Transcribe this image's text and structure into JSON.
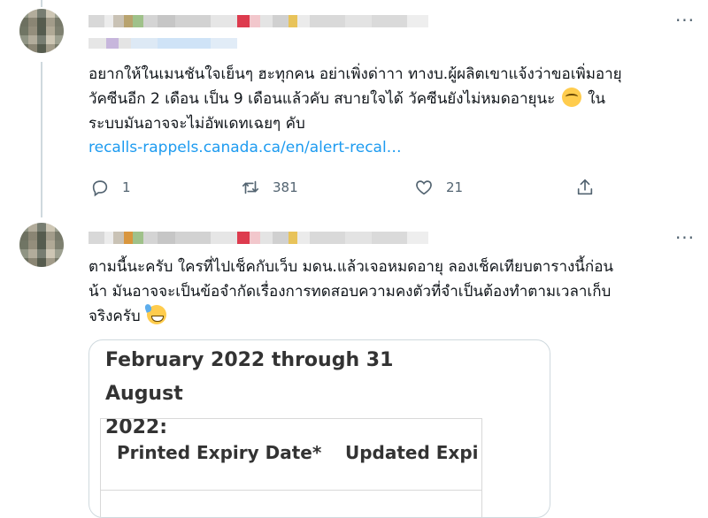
{
  "tweet1": {
    "text_lines": [
      "อยากให้ในเมนชันใจเย็นๆ ฮะทุกคน อย่าเพิ่งด่าาา ทางบ.ผู้ผลิตเขาแจ้งว่าขอเพิ่มอายุ",
      "วัคซีนอีก 2 เดือน เป็น 9 เดือนแล้วคับ สบายใจได้ วัคซีนยังไม่หมดอายุนะ",
      "ระบบมันอาจจะไม่อัพเดทเฉยๆ คับ"
    ],
    "line2_tail": " ใน",
    "link": "recalls-rappels.canada.ca/en/alert-recal…",
    "emoji": "face-with-rolling-eyes-icon",
    "actions": {
      "reply_count": "1",
      "retweet_count": "381",
      "like_count": "21"
    }
  },
  "tweet2": {
    "text_lines": [
      "ตามนี้นะครับ ใครที่ไปเช็คกับเว็บ มดน.แล้วเจอหมดอายุ ลองเช็คเทียบตารางนี้ก่อน",
      "น้า มันอาจจะเป็นข้อจำกัดเรื่องการทดสอบความคงตัวที่จำเป็นต้องทำตามเวลาเก็บ",
      "จริงครับ"
    ],
    "emoji": "grinning-face-with-sweat-icon",
    "image": {
      "heading_line1": "February 2022 through 31 August",
      "heading_line2": "2022:",
      "col1_header": "Printed Expiry Date*",
      "col2_header": "Updated Expi"
    }
  },
  "icons": {
    "more": "more-horizontal-icon",
    "reply": "reply-icon",
    "retweet": "retweet-icon",
    "like": "heart-icon",
    "share": "share-icon"
  },
  "colors": {
    "link": "#1d9bf0",
    "muted": "#536471",
    "border": "#cfd9de",
    "text": "#0f1419"
  }
}
